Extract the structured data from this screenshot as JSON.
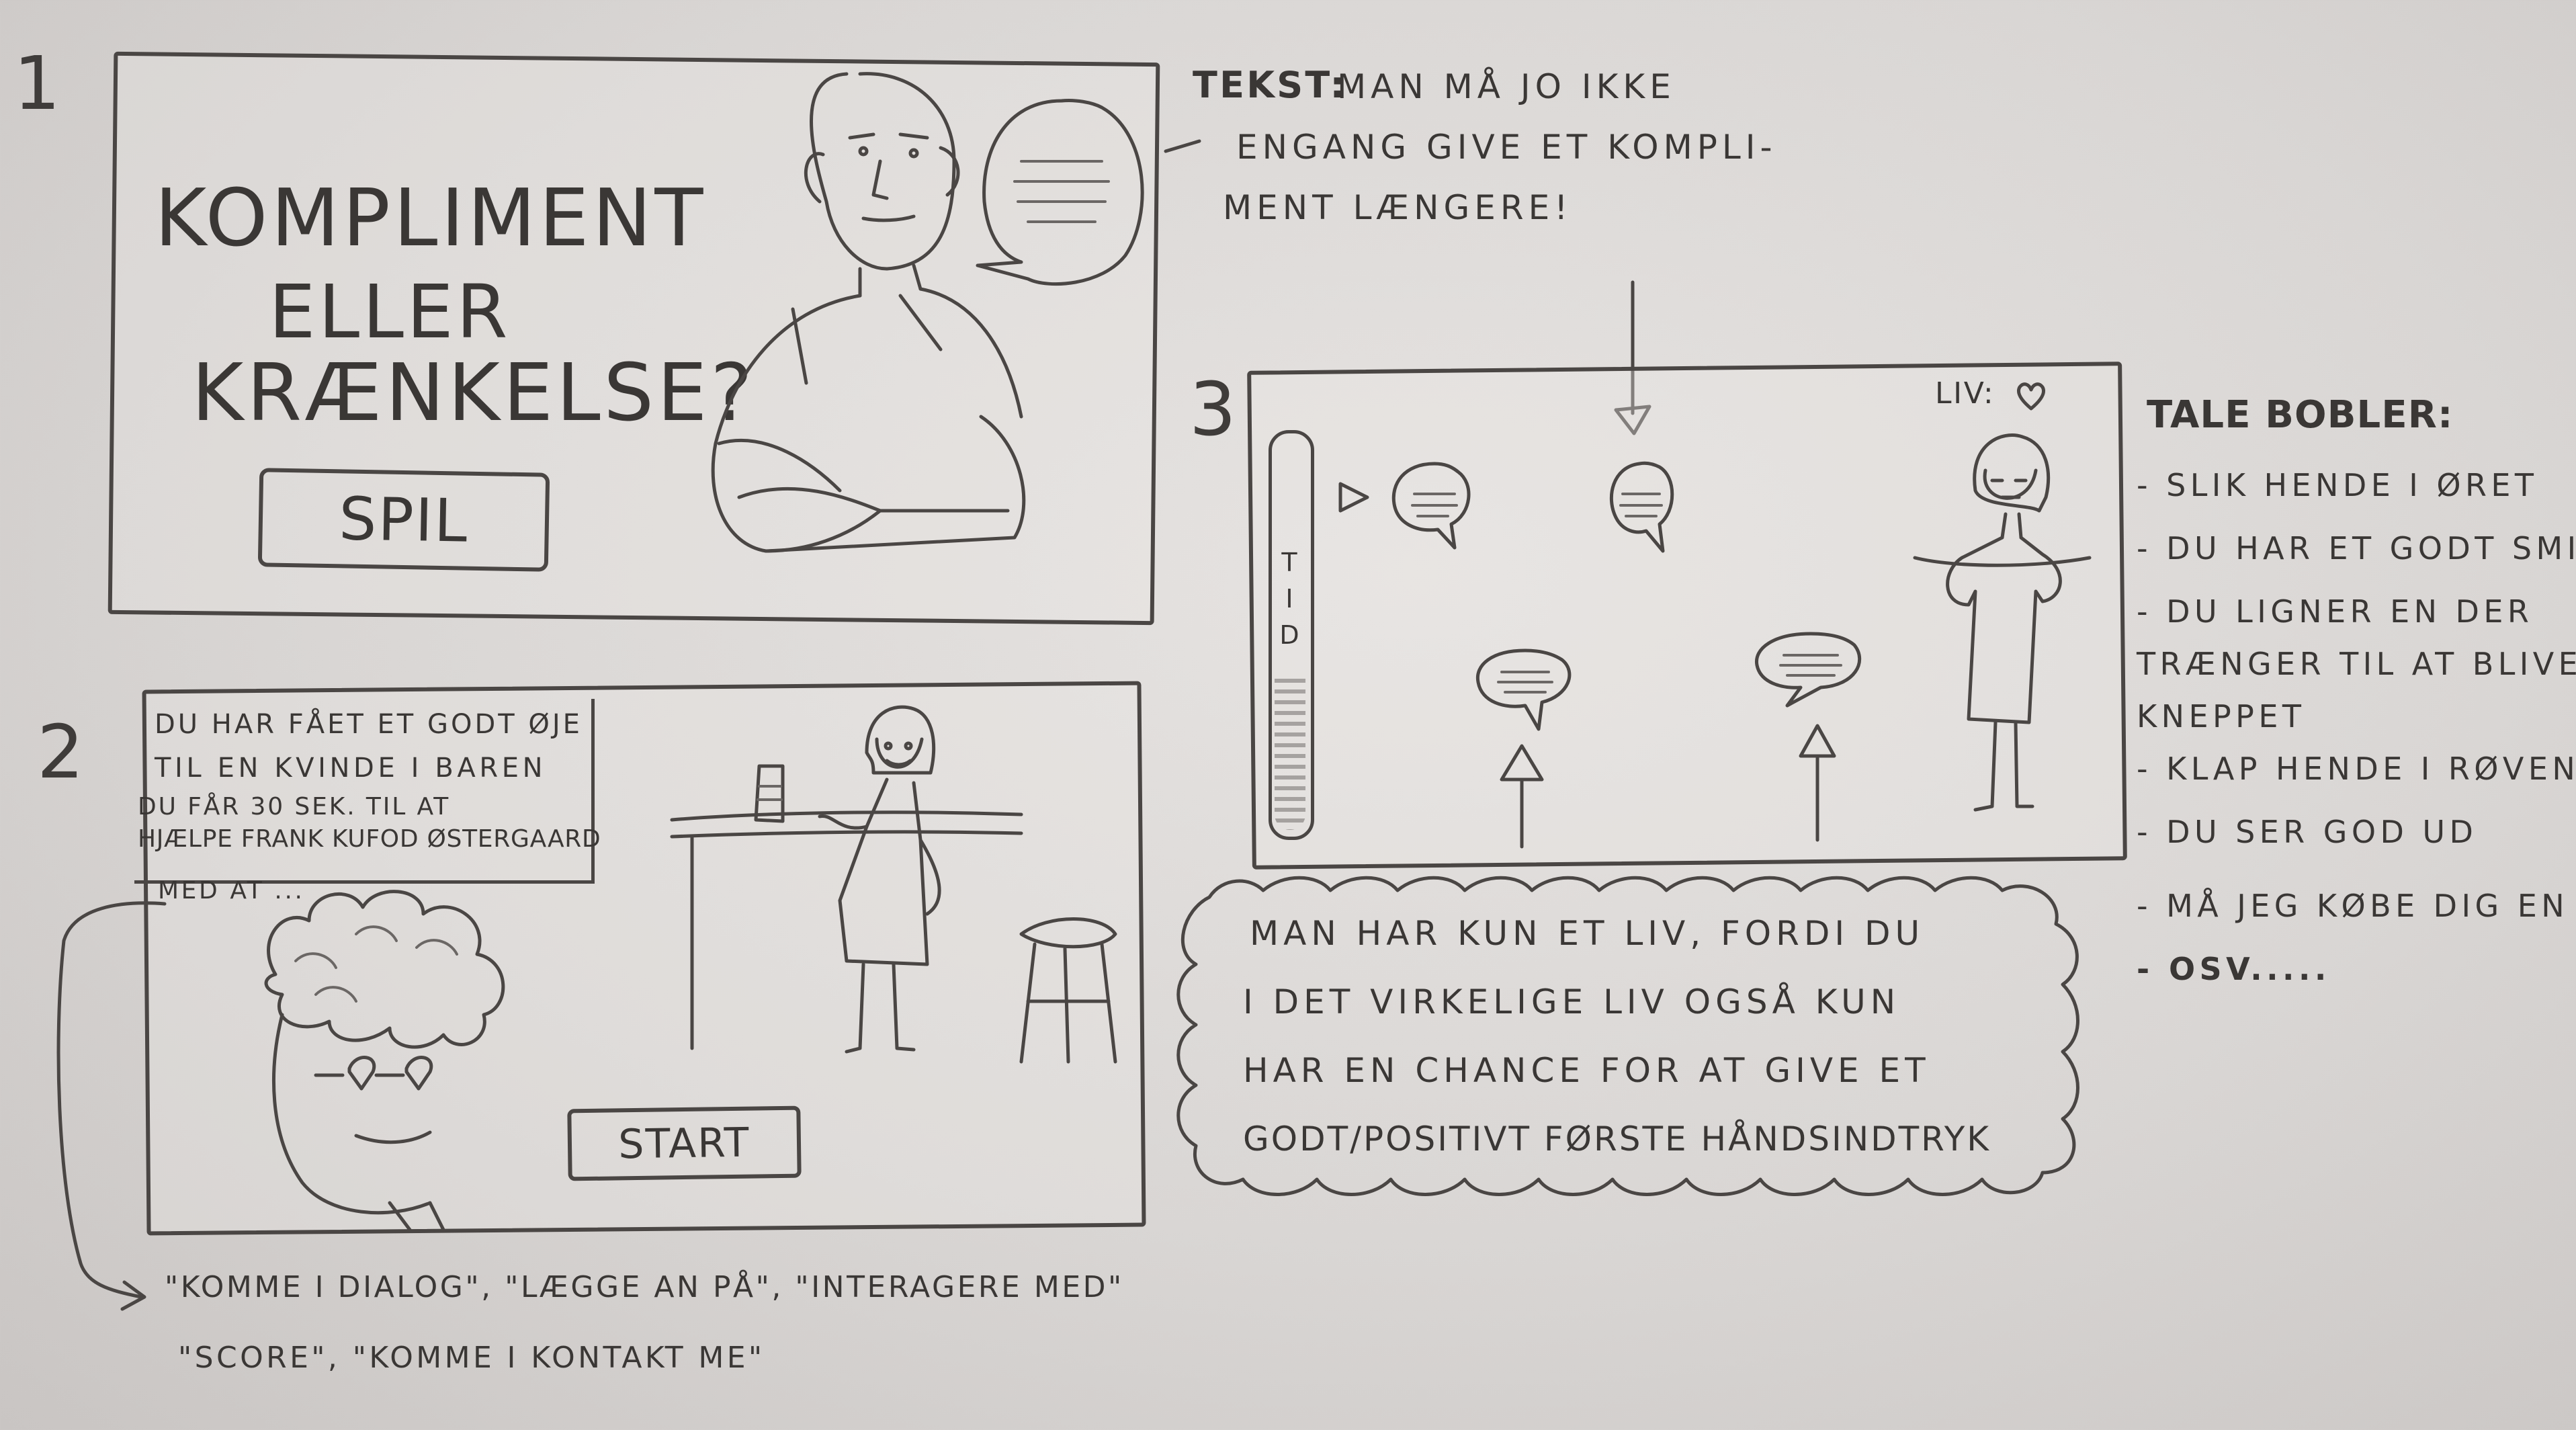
{
  "panel1": {
    "number": "1",
    "title_line1": "KOMPLIMENT",
    "title_line2": "ELLER",
    "title_line3": "KRÆNKELSE?",
    "button_label": "SPIL"
  },
  "note1": {
    "label": "TEKST:",
    "line1": "MAN MÅ JO IKKE",
    "line2": "ENGANG GIVE ET KOMPLI-",
    "line3": "MENT LÆNGERE!"
  },
  "panel2": {
    "number": "2",
    "text_line1": "DU HAR FÅET ET GODT ØJE",
    "text_line2": "TIL EN KVINDE I BAREN",
    "text_line3": "DU FÅR 30 SEK. TIL AT",
    "text_line4": "HJÆLPE FRANK KUFOD ØSTERGAARD",
    "text_line5": "MED AT ...",
    "button_label": "START"
  },
  "note2": {
    "line1": "\"KOMME I DIALOG\", \"LÆGGE AN PÅ\", \"INTERAGERE MED\"",
    "line2": "\"SCORE\", \"KOMME I KONTAKT ME\""
  },
  "panel3": {
    "number": "3",
    "lives_label": "LIV:",
    "timer_label": "TID"
  },
  "talebobler": {
    "title": "TALE BOBLER:",
    "items": [
      "- SLIK HENDE I ØRET",
      "- DU HAR ET GODT SMIL",
      "- DU LIGNER EN DER",
      "TRÆNGER TIL AT BLIVE",
      "KNEPPET",
      "- KLAP HENDE I RØVEN",
      "- DU SER GOD UD",
      "- MÅ JEG KØBE DIG EN Ø",
      "- OSV....."
    ]
  },
  "cloud": {
    "line1": "MAN HAR KUN ET LIV, FORDI DU",
    "line2": "I DET VIRKELIGE LIV OGSÅ KUN",
    "line3": "HAR EN CHANCE FOR AT GIVE ET",
    "line4": "GODT/POSITIVT FØRSTE HÅNDSINDTRYK"
  }
}
